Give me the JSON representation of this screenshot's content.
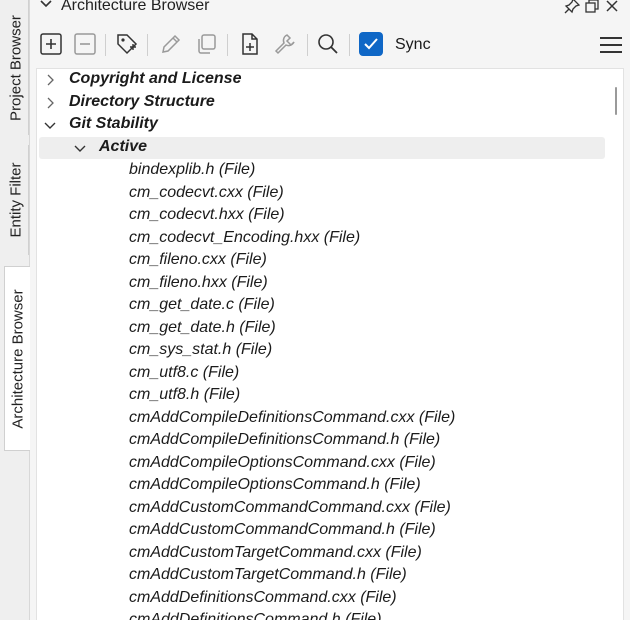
{
  "side_tabs": [
    "Project Browser",
    "Entity Filter",
    "Architecture Browser"
  ],
  "panel": {
    "title": "Architecture Browser"
  },
  "toolbar": {
    "sync_label": "Sync",
    "sync_checked": true
  },
  "tree": {
    "nodes": [
      {
        "label": "Copyright and License",
        "level": 0,
        "expanded": false,
        "bold": true
      },
      {
        "label": "Directory Structure",
        "level": 0,
        "expanded": false,
        "bold": true
      },
      {
        "label": "Git Stability",
        "level": 0,
        "expanded": true,
        "bold": true
      },
      {
        "label": "Active",
        "level": 1,
        "expanded": true,
        "bold": true,
        "highlighted": true
      }
    ],
    "files": [
      "bindexplib.h (File)",
      "cm_codecvt.cxx (File)",
      "cm_codecvt.hxx (File)",
      "cm_codecvt_Encoding.hxx (File)",
      "cm_fileno.cxx (File)",
      "cm_fileno.hxx (File)",
      "cm_get_date.c (File)",
      "cm_get_date.h (File)",
      "cm_sys_stat.h (File)",
      "cm_utf8.c (File)",
      "cm_utf8.h (File)",
      "cmAddCompileDefinitionsCommand.cxx (File)",
      "cmAddCompileDefinitionsCommand.h (File)",
      "cmAddCompileOptionsCommand.cxx (File)",
      "cmAddCompileOptionsCommand.h (File)",
      "cmAddCustomCommandCommand.cxx (File)",
      "cmAddCustomCommandCommand.h (File)",
      "cmAddCustomTargetCommand.cxx (File)",
      "cmAddCustomTargetCommand.h (File)",
      "cmAddDefinitionsCommand.cxx (File)",
      "cmAddDefinitionsCommand.h (File)"
    ]
  }
}
